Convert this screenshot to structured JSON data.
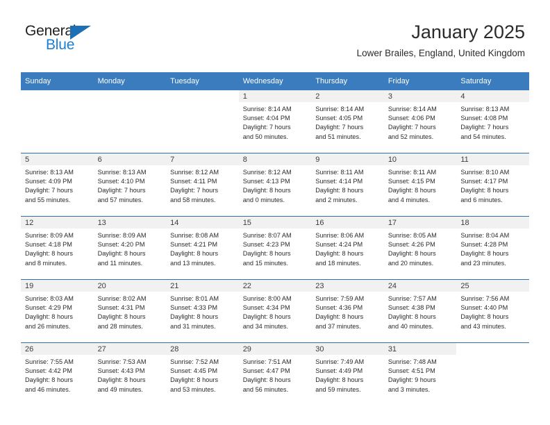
{
  "brand": {
    "word_one": "General",
    "word_two": "Blue",
    "triangle_color": "#1f6fb5",
    "word_two_color": "#1b7fd4",
    "word_one_color": "#231f20"
  },
  "header": {
    "title": "January 2025",
    "subtitle": "Lower Brailes, England, United Kingdom"
  },
  "theme": {
    "header_bg": "#3a7cbe",
    "row_border": "#2f6fae",
    "daynum_bg": "#f1f1f1",
    "page_bg": "#ffffff",
    "text": "#2a2a2a"
  },
  "columns": [
    "Sunday",
    "Monday",
    "Tuesday",
    "Wednesday",
    "Thursday",
    "Friday",
    "Saturday"
  ],
  "weeks": [
    [
      {
        "day": "",
        "sunrise": "",
        "sunset": "",
        "daylight_1": "",
        "daylight_2": ""
      },
      {
        "day": "",
        "sunrise": "",
        "sunset": "",
        "daylight_1": "",
        "daylight_2": ""
      },
      {
        "day": "",
        "sunrise": "",
        "sunset": "",
        "daylight_1": "",
        "daylight_2": ""
      },
      {
        "day": "1",
        "sunrise": "Sunrise: 8:14 AM",
        "sunset": "Sunset: 4:04 PM",
        "daylight_1": "Daylight: 7 hours",
        "daylight_2": "and 50 minutes."
      },
      {
        "day": "2",
        "sunrise": "Sunrise: 8:14 AM",
        "sunset": "Sunset: 4:05 PM",
        "daylight_1": "Daylight: 7 hours",
        "daylight_2": "and 51 minutes."
      },
      {
        "day": "3",
        "sunrise": "Sunrise: 8:14 AM",
        "sunset": "Sunset: 4:06 PM",
        "daylight_1": "Daylight: 7 hours",
        "daylight_2": "and 52 minutes."
      },
      {
        "day": "4",
        "sunrise": "Sunrise: 8:13 AM",
        "sunset": "Sunset: 4:08 PM",
        "daylight_1": "Daylight: 7 hours",
        "daylight_2": "and 54 minutes."
      }
    ],
    [
      {
        "day": "5",
        "sunrise": "Sunrise: 8:13 AM",
        "sunset": "Sunset: 4:09 PM",
        "daylight_1": "Daylight: 7 hours",
        "daylight_2": "and 55 minutes."
      },
      {
        "day": "6",
        "sunrise": "Sunrise: 8:13 AM",
        "sunset": "Sunset: 4:10 PM",
        "daylight_1": "Daylight: 7 hours",
        "daylight_2": "and 57 minutes."
      },
      {
        "day": "7",
        "sunrise": "Sunrise: 8:12 AM",
        "sunset": "Sunset: 4:11 PM",
        "daylight_1": "Daylight: 7 hours",
        "daylight_2": "and 58 minutes."
      },
      {
        "day": "8",
        "sunrise": "Sunrise: 8:12 AM",
        "sunset": "Sunset: 4:13 PM",
        "daylight_1": "Daylight: 8 hours",
        "daylight_2": "and 0 minutes."
      },
      {
        "day": "9",
        "sunrise": "Sunrise: 8:11 AM",
        "sunset": "Sunset: 4:14 PM",
        "daylight_1": "Daylight: 8 hours",
        "daylight_2": "and 2 minutes."
      },
      {
        "day": "10",
        "sunrise": "Sunrise: 8:11 AM",
        "sunset": "Sunset: 4:15 PM",
        "daylight_1": "Daylight: 8 hours",
        "daylight_2": "and 4 minutes."
      },
      {
        "day": "11",
        "sunrise": "Sunrise: 8:10 AM",
        "sunset": "Sunset: 4:17 PM",
        "daylight_1": "Daylight: 8 hours",
        "daylight_2": "and 6 minutes."
      }
    ],
    [
      {
        "day": "12",
        "sunrise": "Sunrise: 8:09 AM",
        "sunset": "Sunset: 4:18 PM",
        "daylight_1": "Daylight: 8 hours",
        "daylight_2": "and 8 minutes."
      },
      {
        "day": "13",
        "sunrise": "Sunrise: 8:09 AM",
        "sunset": "Sunset: 4:20 PM",
        "daylight_1": "Daylight: 8 hours",
        "daylight_2": "and 11 minutes."
      },
      {
        "day": "14",
        "sunrise": "Sunrise: 8:08 AM",
        "sunset": "Sunset: 4:21 PM",
        "daylight_1": "Daylight: 8 hours",
        "daylight_2": "and 13 minutes."
      },
      {
        "day": "15",
        "sunrise": "Sunrise: 8:07 AM",
        "sunset": "Sunset: 4:23 PM",
        "daylight_1": "Daylight: 8 hours",
        "daylight_2": "and 15 minutes."
      },
      {
        "day": "16",
        "sunrise": "Sunrise: 8:06 AM",
        "sunset": "Sunset: 4:24 PM",
        "daylight_1": "Daylight: 8 hours",
        "daylight_2": "and 18 minutes."
      },
      {
        "day": "17",
        "sunrise": "Sunrise: 8:05 AM",
        "sunset": "Sunset: 4:26 PM",
        "daylight_1": "Daylight: 8 hours",
        "daylight_2": "and 20 minutes."
      },
      {
        "day": "18",
        "sunrise": "Sunrise: 8:04 AM",
        "sunset": "Sunset: 4:28 PM",
        "daylight_1": "Daylight: 8 hours",
        "daylight_2": "and 23 minutes."
      }
    ],
    [
      {
        "day": "19",
        "sunrise": "Sunrise: 8:03 AM",
        "sunset": "Sunset: 4:29 PM",
        "daylight_1": "Daylight: 8 hours",
        "daylight_2": "and 26 minutes."
      },
      {
        "day": "20",
        "sunrise": "Sunrise: 8:02 AM",
        "sunset": "Sunset: 4:31 PM",
        "daylight_1": "Daylight: 8 hours",
        "daylight_2": "and 28 minutes."
      },
      {
        "day": "21",
        "sunrise": "Sunrise: 8:01 AM",
        "sunset": "Sunset: 4:33 PM",
        "daylight_1": "Daylight: 8 hours",
        "daylight_2": "and 31 minutes."
      },
      {
        "day": "22",
        "sunrise": "Sunrise: 8:00 AM",
        "sunset": "Sunset: 4:34 PM",
        "daylight_1": "Daylight: 8 hours",
        "daylight_2": "and 34 minutes."
      },
      {
        "day": "23",
        "sunrise": "Sunrise: 7:59 AM",
        "sunset": "Sunset: 4:36 PM",
        "daylight_1": "Daylight: 8 hours",
        "daylight_2": "and 37 minutes."
      },
      {
        "day": "24",
        "sunrise": "Sunrise: 7:57 AM",
        "sunset": "Sunset: 4:38 PM",
        "daylight_1": "Daylight: 8 hours",
        "daylight_2": "and 40 minutes."
      },
      {
        "day": "25",
        "sunrise": "Sunrise: 7:56 AM",
        "sunset": "Sunset: 4:40 PM",
        "daylight_1": "Daylight: 8 hours",
        "daylight_2": "and 43 minutes."
      }
    ],
    [
      {
        "day": "26",
        "sunrise": "Sunrise: 7:55 AM",
        "sunset": "Sunset: 4:42 PM",
        "daylight_1": "Daylight: 8 hours",
        "daylight_2": "and 46 minutes."
      },
      {
        "day": "27",
        "sunrise": "Sunrise: 7:53 AM",
        "sunset": "Sunset: 4:43 PM",
        "daylight_1": "Daylight: 8 hours",
        "daylight_2": "and 49 minutes."
      },
      {
        "day": "28",
        "sunrise": "Sunrise: 7:52 AM",
        "sunset": "Sunset: 4:45 PM",
        "daylight_1": "Daylight: 8 hours",
        "daylight_2": "and 53 minutes."
      },
      {
        "day": "29",
        "sunrise": "Sunrise: 7:51 AM",
        "sunset": "Sunset: 4:47 PM",
        "daylight_1": "Daylight: 8 hours",
        "daylight_2": "and 56 minutes."
      },
      {
        "day": "30",
        "sunrise": "Sunrise: 7:49 AM",
        "sunset": "Sunset: 4:49 PM",
        "daylight_1": "Daylight: 8 hours",
        "daylight_2": "and 59 minutes."
      },
      {
        "day": "31",
        "sunrise": "Sunrise: 7:48 AM",
        "sunset": "Sunset: 4:51 PM",
        "daylight_1": "Daylight: 9 hours",
        "daylight_2": "and 3 minutes."
      },
      {
        "day": "",
        "sunrise": "",
        "sunset": "",
        "daylight_1": "",
        "daylight_2": ""
      }
    ]
  ]
}
